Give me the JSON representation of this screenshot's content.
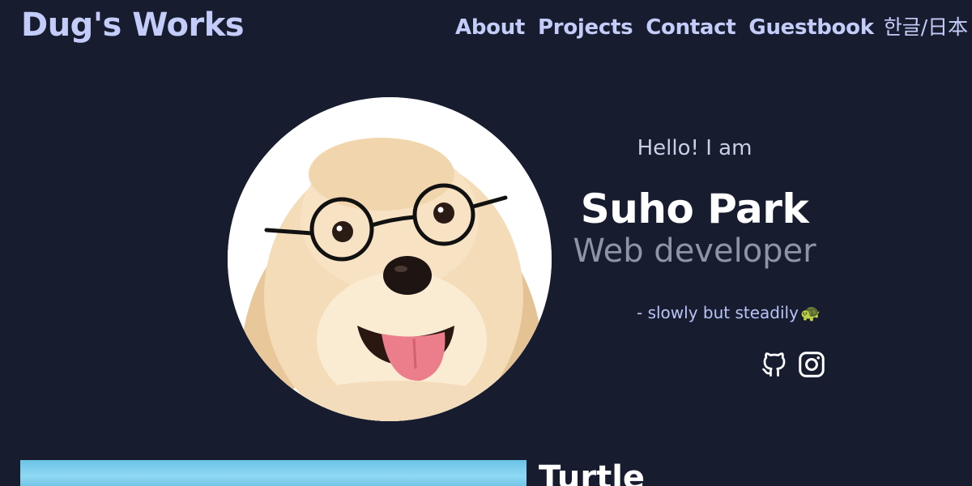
{
  "header": {
    "brand": "Dug's Works",
    "nav": {
      "about": "About",
      "projects": "Projects",
      "contact": "Contact",
      "guestbook": "Guestbook",
      "language": "한글/日本"
    }
  },
  "intro": {
    "greeting": "Hello! I am",
    "name": "Suho Park",
    "role": "Web developer",
    "motto": "- slowly but steadily",
    "motto_emoji": "🐢"
  },
  "socials": [
    {
      "icon": "github-icon"
    },
    {
      "icon": "instagram-icon"
    }
  ],
  "project": {
    "title": "Turtle"
  },
  "colors": {
    "background": "#171d2f",
    "accent": "#c4cdfa",
    "muted": "#8e93a6",
    "text": "#ffffff"
  }
}
